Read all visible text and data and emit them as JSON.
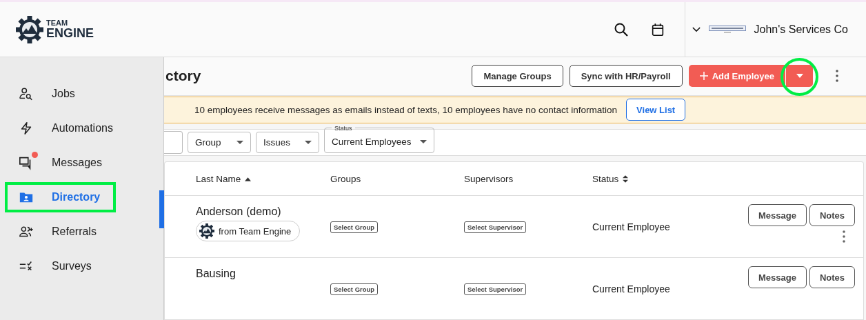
{
  "header": {
    "logo": {
      "line_1": "TEAM",
      "line_2": "ENGINE"
    },
    "company": "John's Services Co"
  },
  "sidebar": {
    "items": [
      {
        "label": "Jobs",
        "kind": "jobs",
        "selected": false,
        "unread": false,
        "highlighted": false
      },
      {
        "label": "Automations",
        "kind": "automations",
        "selected": false,
        "unread": false,
        "highlighted": false
      },
      {
        "label": "Messages",
        "kind": "messages",
        "selected": false,
        "unread": true,
        "highlighted": false
      },
      {
        "label": "Directory",
        "kind": "directory",
        "selected": true,
        "unread": false,
        "highlighted": true
      },
      {
        "label": "Referrals",
        "kind": "referrals",
        "selected": false,
        "unread": false,
        "highlighted": false
      },
      {
        "label": "Surveys",
        "kind": "surveys",
        "selected": false,
        "unread": false,
        "highlighted": false
      }
    ]
  },
  "page": {
    "title": "ctory",
    "buttons": [
      {
        "label": "Manage Groups",
        "kind": "outline"
      },
      {
        "label": "Sync with HR/Payroll",
        "kind": "outline"
      },
      {
        "label": "Add Employee",
        "kind": "split",
        "highlighted": true
      }
    ]
  },
  "banner": {
    "text": "10 employees receive messages as emails instead of texts, 10 employees have no contact information",
    "button": "View List"
  },
  "filters": [
    {
      "kind": "search"
    },
    {
      "kind": "select",
      "value": "Group"
    },
    {
      "kind": "select",
      "value": "Issues"
    },
    {
      "kind": "labeled",
      "label": "Status",
      "value": "Current Employees"
    }
  ],
  "table": {
    "columns": [
      {
        "label": "Last Name",
        "kind": "sorted_asc"
      },
      {
        "label": "Groups",
        "kind": "plain"
      },
      {
        "label": "Supervisors",
        "kind": "plain"
      },
      {
        "label": "Status",
        "kind": "sortable"
      }
    ],
    "rows": [
      {
        "last_name": "Anderson (demo)",
        "source": "from Team Engine",
        "group": "Select Group",
        "supervisor": "Select Supervisor",
        "status": "Current Employee",
        "actions": [
          "Message",
          "Notes"
        ]
      },
      {
        "last_name": "Bausing",
        "group": "Select Group",
        "supervisor": "Select Supervisor",
        "status": "Current Employee",
        "actions": [
          "Message",
          "Notes"
        ]
      }
    ]
  }
}
